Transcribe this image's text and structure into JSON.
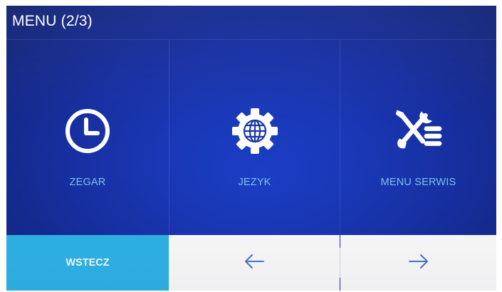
{
  "header": {
    "title": "MENU (2/3)"
  },
  "menu_items": [
    {
      "label": "ZEGAR",
      "icon": "clock-icon"
    },
    {
      "label": "JEZYK",
      "icon": "language-globe-gear-icon"
    },
    {
      "label": "MENU SERWIS",
      "icon": "service-tools-icon"
    }
  ],
  "footer": {
    "back_label": "WSTECZ",
    "prev_icon": "arrow-left-icon",
    "next_icon": "arrow-right-icon"
  },
  "colors": {
    "background": "#172fa0",
    "label_text": "#7cc6f0",
    "back_button": "#2fb6ea",
    "arrow": "#4a78d0"
  }
}
